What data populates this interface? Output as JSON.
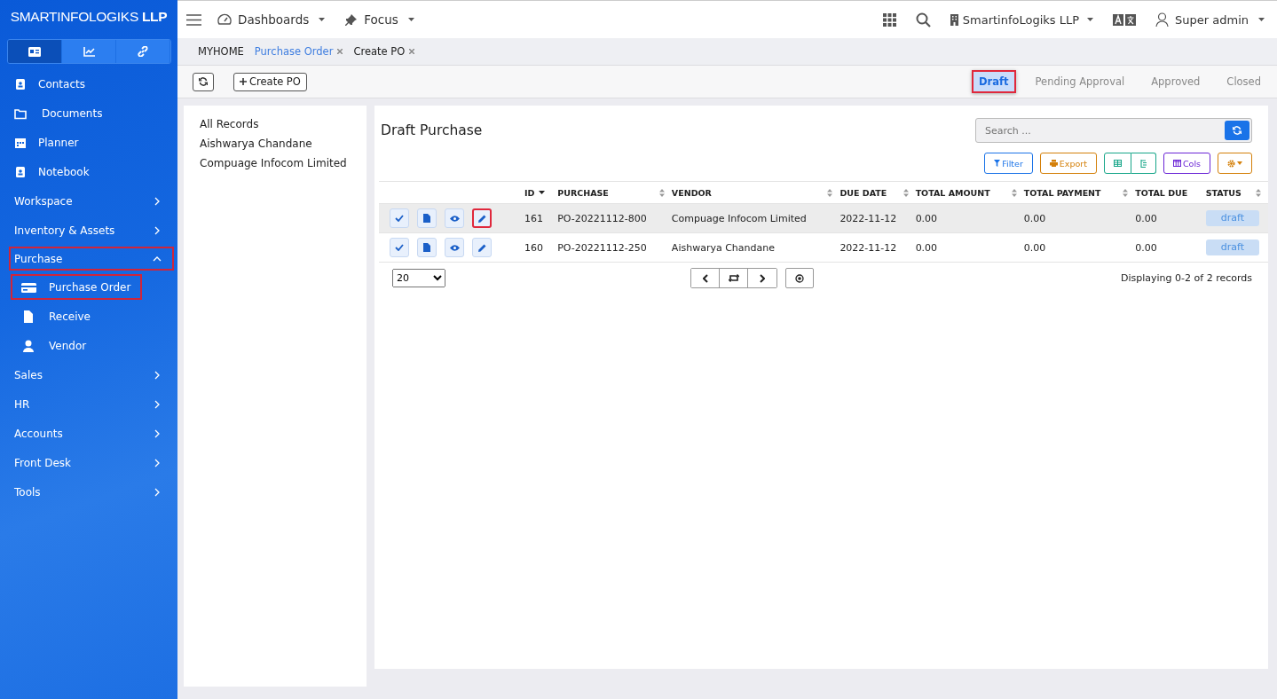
{
  "brand": {
    "name": "SMARTINFOLOGIKS",
    "suffix": "LLP"
  },
  "sidebar_tabs": [
    {
      "selected": true
    },
    {
      "selected": false
    },
    {
      "selected": false
    }
  ],
  "sidebar": [
    {
      "label": "Contacts",
      "kind": "link"
    },
    {
      "label": "Documents",
      "kind": "link"
    },
    {
      "label": "Planner",
      "kind": "link"
    },
    {
      "label": "Notebook",
      "kind": "link"
    },
    {
      "label": "Workspace",
      "kind": "group",
      "expanded": false,
      "highlighted": false
    },
    {
      "label": "Inventory & Assets",
      "kind": "group",
      "expanded": false,
      "highlighted": false
    },
    {
      "label": "Purchase",
      "kind": "group",
      "expanded": true,
      "highlighted": true,
      "children": [
        {
          "label": "Purchase Order",
          "highlighted": true
        },
        {
          "label": "Receive",
          "highlighted": false
        },
        {
          "label": "Vendor",
          "highlighted": false
        }
      ]
    },
    {
      "label": "Sales",
      "kind": "group",
      "expanded": false,
      "highlighted": false
    },
    {
      "label": "HR",
      "kind": "group",
      "expanded": false,
      "highlighted": false
    },
    {
      "label": "Accounts",
      "kind": "group",
      "expanded": false,
      "highlighted": false
    },
    {
      "label": "Front Desk",
      "kind": "group",
      "expanded": false,
      "highlighted": false
    },
    {
      "label": "Tools",
      "kind": "group",
      "expanded": false,
      "highlighted": false
    }
  ],
  "topbar": {
    "menus": [
      "Dashboards",
      "Focus"
    ],
    "company": "SmartinfoLogiks LLP",
    "user": "Super admin"
  },
  "breadcrumbs": [
    {
      "label": "MYHOME",
      "closable": false,
      "selected": false
    },
    {
      "label": "Purchase Order",
      "closable": true,
      "selected": true
    },
    {
      "label": "Create PO",
      "closable": true,
      "selected": false
    }
  ],
  "toolbar": {
    "create_label": "Create PO"
  },
  "status_tabs": [
    {
      "label": "Draft",
      "selected": true,
      "highlighted": true
    },
    {
      "label": "Pending Approval",
      "selected": false,
      "highlighted": false
    },
    {
      "label": "Approved",
      "selected": false,
      "highlighted": false
    },
    {
      "label": "Closed",
      "selected": false,
      "highlighted": false
    }
  ],
  "filters": [
    "All Records",
    "Aishwarya Chandane",
    "Compuage Infocom Limited"
  ],
  "card": {
    "title": "Draft Purchase",
    "search": {
      "placeholder": "Search ..."
    },
    "filter_label": "Filter",
    "export_label": "Export",
    "cols_label": "Cols"
  },
  "table": {
    "columns": [
      {
        "label": "ID",
        "sortable": true,
        "sorted_desc": true
      },
      {
        "label": "PURCHASE",
        "sortable": true,
        "sorted_desc": false
      },
      {
        "label": "VENDOR",
        "sortable": true,
        "sorted_desc": false
      },
      {
        "label": "DUE DATE",
        "sortable": true,
        "sorted_desc": false
      },
      {
        "label": "TOTAL AMOUNT",
        "sortable": true,
        "sorted_desc": false
      },
      {
        "label": "TOTAL PAYMENT",
        "sortable": true,
        "sorted_desc": false
      },
      {
        "label": "TOTAL DUE",
        "sortable": false,
        "sorted_desc": false
      },
      {
        "label": "STATUS",
        "sortable": true,
        "sorted_desc": false
      }
    ],
    "rows": [
      {
        "selected": true,
        "edit_highlighted": true,
        "cells": [
          "161",
          "PO-20221112-800",
          "Compuage Infocom Limited",
          "2022-11-12",
          "0.00",
          "0.00",
          "0.00"
        ],
        "status": "draft"
      },
      {
        "selected": false,
        "edit_highlighted": false,
        "cells": [
          "160",
          "PO-20221112-250",
          "Aishwarya Chandane",
          "2022-11-12",
          "0.00",
          "0.00",
          "0.00"
        ],
        "status": "draft"
      }
    ]
  },
  "pager": {
    "page_size": "20",
    "info": "Displaying 0-2 of 2 records"
  }
}
